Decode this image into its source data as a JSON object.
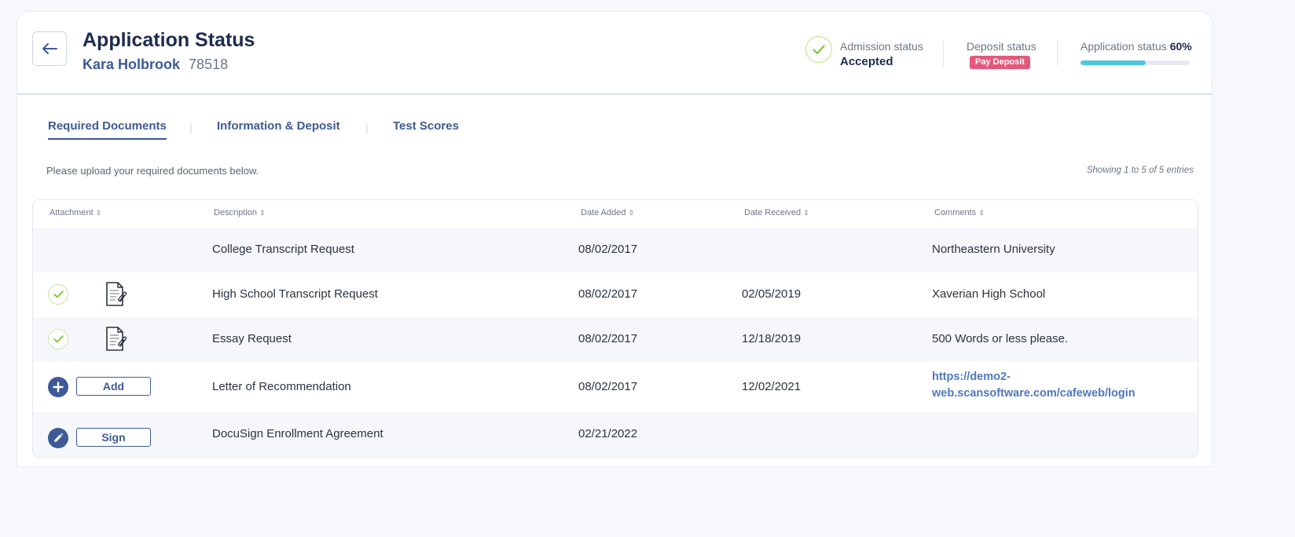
{
  "header": {
    "title": "Application Status",
    "student_name": "Kara Holbrook",
    "student_id": "78518"
  },
  "status": {
    "admission_label": "Admission status",
    "admission_value": "Accepted",
    "deposit_label": "Deposit status",
    "deposit_badge": "Pay Deposit",
    "application_label": "Application status",
    "application_percent_text": "60%",
    "application_progress": 0.6
  },
  "tabs": [
    {
      "label": "Required Documents",
      "active": true
    },
    {
      "label": "Information & Deposit",
      "active": false
    },
    {
      "label": "Test Scores",
      "active": false
    }
  ],
  "instructions": "Please upload your required documents below.",
  "entries_info": "Showing 1 to 5 of 5 entries",
  "table": {
    "columns": [
      "Attachment",
      "Description",
      "Date Added",
      "Date Received",
      "Comments"
    ],
    "rows": [
      {
        "description": "College Transcript Request",
        "date_added": "08/02/2017",
        "date_received": "",
        "comment": "Northeastern University"
      },
      {
        "description": "High School Transcript Request",
        "date_added": "08/02/2017",
        "date_received": "02/05/2019",
        "comment": "Xaverian High School"
      },
      {
        "description": "Essay Request",
        "date_added": "08/02/2017",
        "date_received": "12/18/2019",
        "comment": "500 Words or less please."
      },
      {
        "description": "Letter of Recommendation",
        "date_added": "08/02/2017",
        "date_received": "12/02/2021",
        "comment_line1": "https://demo2-",
        "comment_line2": "web.scansoftware.com/cafeweb/login",
        "action_label": "Add"
      },
      {
        "description": "DocuSign Enrollment Agreement",
        "date_added": "02/21/2022",
        "date_received": "",
        "comment": "",
        "action_label": "Sign"
      }
    ]
  },
  "colors": {
    "primary": "#3d5a96",
    "badge": "#e4587a",
    "progress": "#4fc6df",
    "check": "#7ccc3a",
    "link": "#4f78bd"
  },
  "icons": {
    "back": "arrow-left-icon",
    "accepted": "check-icon",
    "document": "document-attachment-icon",
    "add": "plus-icon",
    "sign": "pencil-icon",
    "sort": "sort-icon"
  }
}
